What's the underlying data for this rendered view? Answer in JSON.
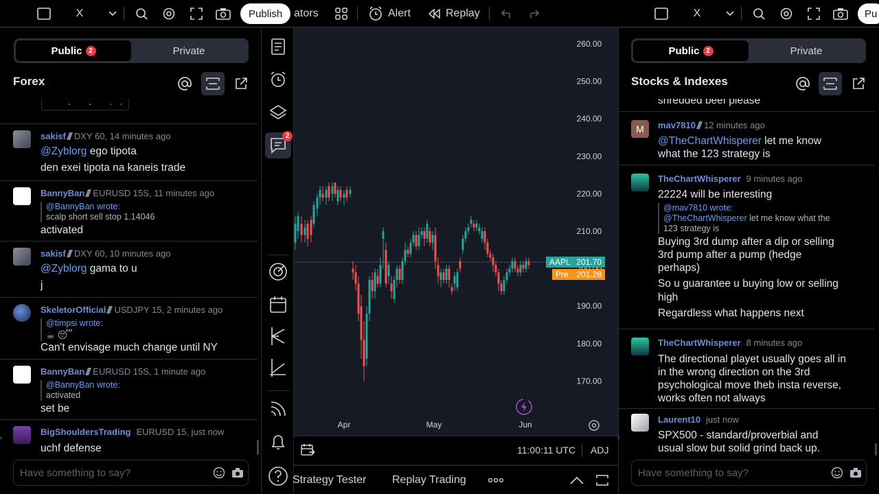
{
  "toolbar": {
    "left": {
      "symbol_close": "X",
      "publish_label": "Publish",
      "indicators_label": "ators",
      "alert_label": "Alert",
      "replay_label": "Replay"
    },
    "right": {
      "symbol_close": "X",
      "publish_label": "Pu"
    }
  },
  "left_panel": {
    "tabs": [
      {
        "label": "Public",
        "badge": "2"
      },
      {
        "label": "Private"
      }
    ],
    "room_title": "Forex",
    "input_placeholder": "Have something to say?",
    "messages": [
      {
        "user": "sakisf",
        "symbol": "DXY 60, 14 minutes ago",
        "lines": [
          "@Zyblorg ego tipota",
          "den exei tipota na kaneis trade"
        ],
        "mention": "@Zyblorg"
      },
      {
        "user": "BannyBan",
        "symbol": "EURUSD 15S, 11 minutes ago",
        "quote_user": "@BannyBan wrote:",
        "quote_text": "scalp short sell stop 1.14046",
        "text": "activated"
      },
      {
        "user": "sakisf",
        "symbol": "DXY 60, 10 minutes ago",
        "lines": [
          "@Zyblorg gama to u",
          "j"
        ],
        "mention": "@Zyblorg"
      },
      {
        "user": "SkeletorOfficial",
        "symbol": "USDJPY 15, 2 minutes ago",
        "quote_user": "@timpsi wrote:",
        "quote_text": "☕ 😴",
        "text": "Can't envisage much change until NY"
      },
      {
        "user": "BannyBan",
        "symbol": "EURUSD 15S, 1 minute ago",
        "quote_user": "@BannyBan wrote:",
        "quote_text": "activated",
        "text": "set be"
      },
      {
        "user": "BigShouldersTrading",
        "symbol": "EURUSD 15, just now",
        "text": "uchf defense"
      }
    ]
  },
  "right_panel": {
    "tabs": [
      {
        "label": "Public",
        "badge": "2"
      },
      {
        "label": "Private"
      }
    ],
    "room_title": "Stocks & Indexes",
    "input_placeholder": "Have something to say?",
    "partial_text": "shredded beef please",
    "messages": [
      {
        "avatar_letter": "M",
        "user": "mav7810",
        "symbol": "12 minutes ago",
        "lines": [
          "@TheChartWhisperer let me know",
          "what the 123 strategy is"
        ],
        "mention": "@TheChartWhisperer"
      },
      {
        "user": "TheChartWhisperer",
        "symbol": "9 minutes ago",
        "text": "22224 will be interesting",
        "quote_user": "@mav7810 wrote:",
        "quote_lines": [
          "@TheChartWhisperer let me know what the",
          "123 strategy is"
        ],
        "extra": [
          "Buying 3rd dump after a dip or selling",
          "3rd pump after a pump (hedge",
          "perhaps)",
          "So u guarantee u buying low or selling",
          "high",
          "Regardless what happens next"
        ]
      },
      {
        "user": "TheChartWhisperer",
        "symbol": "8 minutes ago",
        "lines": [
          "The directional playet usually goes all in",
          "in the wrong direction on the 3rd",
          "psychological move theb insta reverse,",
          "works often not always"
        ]
      },
      {
        "user": "Laurent10",
        "symbol": "just now",
        "lines": [
          "SPX500 - standard/proverbial and",
          "usual slow but solid grind back up."
        ]
      }
    ]
  },
  "chart": {
    "time": "11:00:11 UTC",
    "adj": "ADJ",
    "x_labels": [
      "Apr",
      "May",
      "Jun"
    ],
    "y_labels": [
      "260.00",
      "250.00",
      "240.00",
      "230.00",
      "220.00",
      "210.00",
      "200.00",
      "190.00",
      "180.00",
      "170.00"
    ],
    "last_symbol": "AAPL",
    "last_price": "201.70",
    "pre_label": "Pre",
    "pre_price": "201.28",
    "colors": {
      "up": "#26a69a",
      "down": "#ef5350",
      "last": "#26a69a",
      "pre": "#f7931a"
    }
  },
  "bottom_tabs": {
    "strategy": "Strategy Tester",
    "replay": "Replay Trading"
  },
  "vtool_badge": "2"
}
